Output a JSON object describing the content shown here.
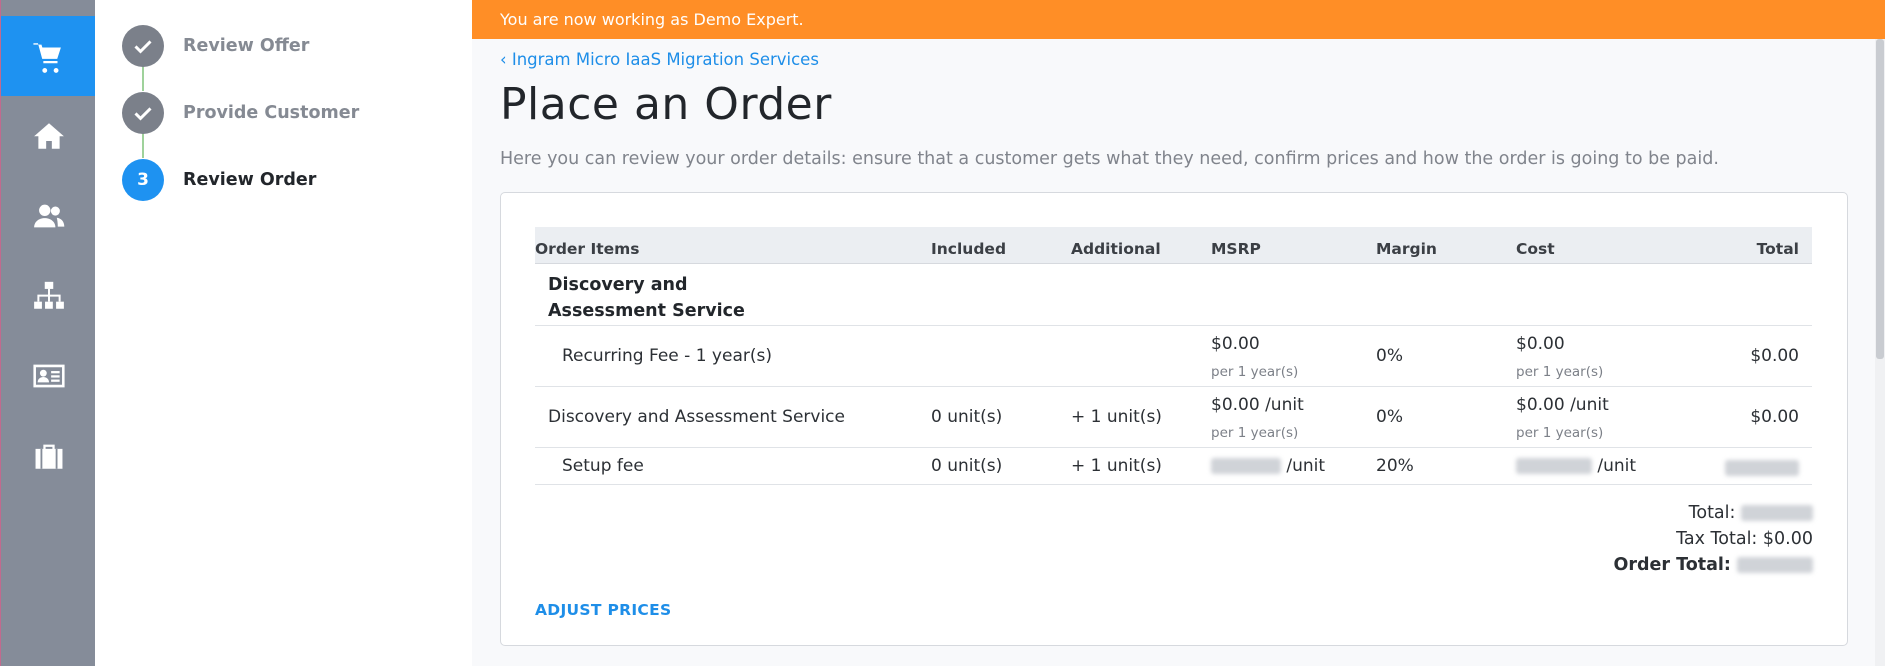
{
  "rail": {
    "items": [
      {
        "icon": "cart-icon",
        "active": true
      },
      {
        "icon": "home-icon"
      },
      {
        "icon": "users-icon"
      },
      {
        "icon": "hierarchy-icon"
      },
      {
        "icon": "contact-card-icon"
      },
      {
        "icon": "briefcase-icon"
      }
    ]
  },
  "steps": [
    {
      "label": "Review Offer",
      "state": "done"
    },
    {
      "label": "Provide Customer",
      "state": "done"
    },
    {
      "number": "3",
      "label": "Review Order",
      "state": "current"
    }
  ],
  "banner": {
    "text": "You are now working as Demo Expert."
  },
  "back_link": "Ingram Micro IaaS Migration Services",
  "title": "Place an Order",
  "description": "Here you can review your order details: ensure that a customer gets what they need, confirm prices and how the order is going to be paid.",
  "table": {
    "headers": {
      "items": "Order Items",
      "included": "Included",
      "additional": "Additional",
      "msrp": "MSRP",
      "margin": "Margin",
      "cost": "Cost",
      "total": "Total"
    },
    "group_title_line1": "Discovery and",
    "group_title_line2": "Assessment Service",
    "rows": [
      {
        "name": "Recurring Fee - 1 year(s)",
        "msrp": "$0.00",
        "msrp_sub": "per 1 year(s)",
        "margin": "0%",
        "cost": "$0.00",
        "cost_sub": "per 1 year(s)",
        "total": "$0.00"
      },
      {
        "name": "Discovery and Assessment Service",
        "included": "0 unit(s)",
        "additional": "+ 1 unit(s)",
        "msrp": "$0.00 /unit",
        "msrp_sub": "per 1 year(s)",
        "margin": "0%",
        "cost": "$0.00 /unit",
        "cost_sub": "per 1 year(s)",
        "total": "$0.00"
      },
      {
        "name": "Setup fee",
        "included": "0 unit(s)",
        "additional": "+ 1 unit(s)",
        "msrp_unit": "/unit",
        "margin": "20%",
        "cost_unit": "/unit"
      }
    ]
  },
  "totals": {
    "total_label": "Total:",
    "tax_total": "Tax Total: $0.00",
    "order_total_label": "Order Total:"
  },
  "adjust_prices": "ADJUST PRICES",
  "colors": {
    "accent": "#1e92f1",
    "banner": "#ff8e26",
    "rail": "#858c99",
    "step_done": "#7b808a",
    "step_line": "#9fd29b"
  }
}
